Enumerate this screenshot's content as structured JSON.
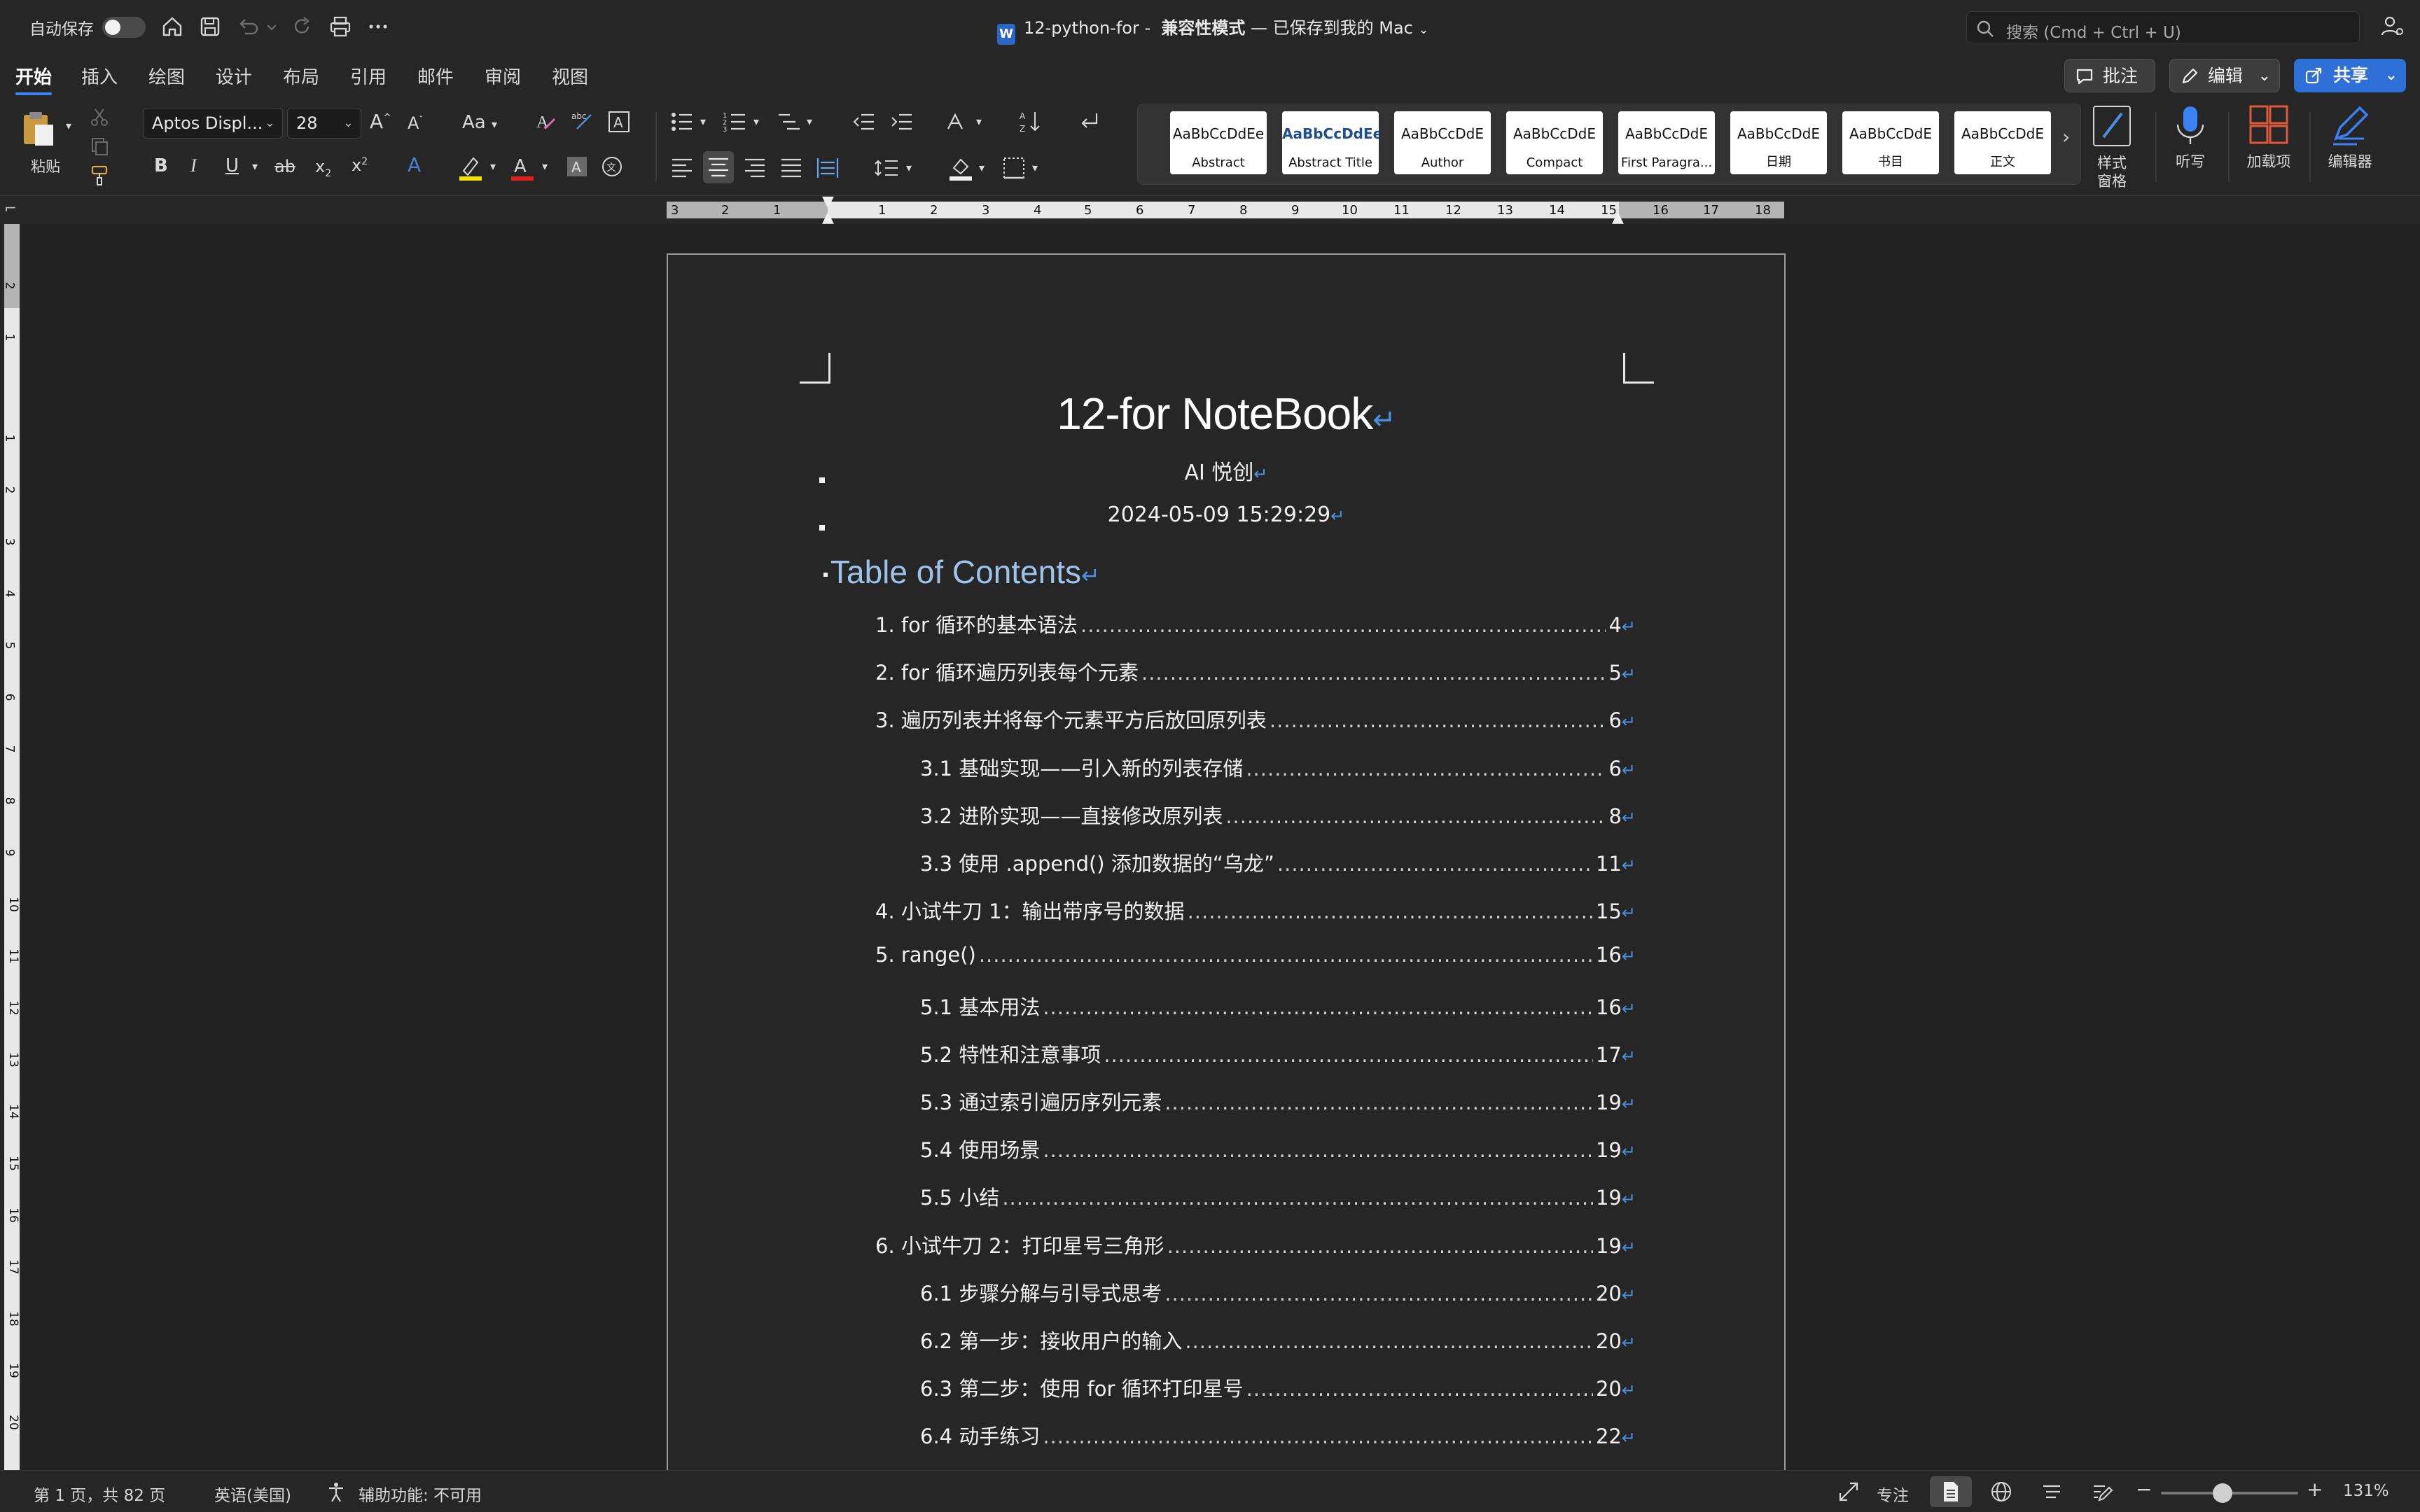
{
  "titlebar": {
    "autosave_label": "自动保存",
    "doc_name": "12-python-for",
    "mode": "兼容性模式",
    "save_status": "— 已保存到我的 Mac",
    "search_placeholder": "搜索 (Cmd + Ctrl + U)"
  },
  "tabs": [
    "开始",
    "插入",
    "绘图",
    "设计",
    "布局",
    "引用",
    "邮件",
    "审阅",
    "视图"
  ],
  "actions": {
    "comment": "批注",
    "edit": "编辑",
    "share": "共享"
  },
  "ribbon": {
    "paste_label": "粘贴",
    "font_name": "Aptos Displ...",
    "font_size": "28",
    "change_case": "Aa",
    "styles": [
      {
        "sample": "AaBbCcDdEe",
        "name": "Abstract"
      },
      {
        "sample": "AaBbCcDdEe",
        "name": "Abstract Title"
      },
      {
        "sample": "AaBbCcDdE",
        "name": "Author"
      },
      {
        "sample": "AaBbCcDdE",
        "name": "Compact"
      },
      {
        "sample": "AaBbCcDdE",
        "name": "First Paragra..."
      },
      {
        "sample": "AaBbCcDdE",
        "name": "日期"
      },
      {
        "sample": "AaBbCcDdE",
        "name": "书目"
      },
      {
        "sample": "AaBbCcDdE",
        "name": "正文"
      }
    ],
    "styles_pane_label": "样式\n窗格",
    "dictate_label": "听写",
    "addins_label": "加载项",
    "editor_label": "编辑器"
  },
  "ruler": {
    "h_ticks": [
      "3",
      "2",
      "1",
      "1",
      "2",
      "3",
      "4",
      "5",
      "6",
      "7",
      "8",
      "9",
      "10",
      "11",
      "12",
      "13",
      "14",
      "15",
      "16",
      "17",
      "18"
    ],
    "v_ticks": [
      "2",
      "1",
      "1",
      "2",
      "3",
      "4",
      "5",
      "6",
      "7",
      "8",
      "9",
      "10",
      "11",
      "12",
      "13",
      "14",
      "15",
      "16",
      "17",
      "18",
      "19",
      "20"
    ]
  },
  "document": {
    "title": "12-for NoteBook",
    "author": "AI 悦创",
    "date": "2024-05-09 15:29:29",
    "toc_heading": "Table of Contents",
    "toc": [
      {
        "text": "1. for 循环的基本语法",
        "page": "4",
        "level": 1
      },
      {
        "text": "2. for 循环遍历列表每个元素",
        "page": "5",
        "level": 1
      },
      {
        "text": "3. 遍历列表并将每个元素平方后放回原列表",
        "page": "6",
        "level": 1
      },
      {
        "text": "3.1 基础实现——引入新的列表存储",
        "page": "6",
        "level": 2
      },
      {
        "text": "3.2 进阶实现——直接修改原列表",
        "page": "8",
        "level": 2
      },
      {
        "text": "3.3 使用 .append() 添加数据的“乌龙”",
        "page": "11",
        "level": 2
      },
      {
        "text": "4. 小试牛刀 1：输出带序号的数据",
        "page": "15",
        "level": 1
      },
      {
        "text": "5. range()",
        "page": "16",
        "level": 1
      },
      {
        "text": "5.1 基本用法",
        "page": "16",
        "level": 2
      },
      {
        "text": "5.2 特性和注意事项",
        "page": "17",
        "level": 2
      },
      {
        "text": "5.3 通过索引遍历序列元素",
        "page": "19",
        "level": 2
      },
      {
        "text": "5.4 使用场景",
        "page": "19",
        "level": 2
      },
      {
        "text": "5.5 小结",
        "page": "19",
        "level": 2
      },
      {
        "text": "6. 小试牛刀 2：打印星号三角形",
        "page": "19",
        "level": 1
      },
      {
        "text": "6.1 步骤分解与引导式思考",
        "page": "20",
        "level": 2
      },
      {
        "text": "6.2 第一步：接收用户的输入",
        "page": "20",
        "level": 2
      },
      {
        "text": "6.3 第二步：使用 for 循环打印星号",
        "page": "20",
        "level": 2
      },
      {
        "text": "6.4 动手练习",
        "page": "22",
        "level": 2
      }
    ]
  },
  "statusbar": {
    "page_info": "第 1 页，共 82 页",
    "language": "英语(美国)",
    "accessibility": "辅助功能: 不可用",
    "focus": "专注",
    "zoom": "131%",
    "zoom_level_fraction": 0.45
  },
  "colors": {
    "accent": "#3b82f6",
    "share_button": "#2e6fd8",
    "toc_heading": "#9ec3ea",
    "paragraph_mark": "#4a90e2"
  }
}
